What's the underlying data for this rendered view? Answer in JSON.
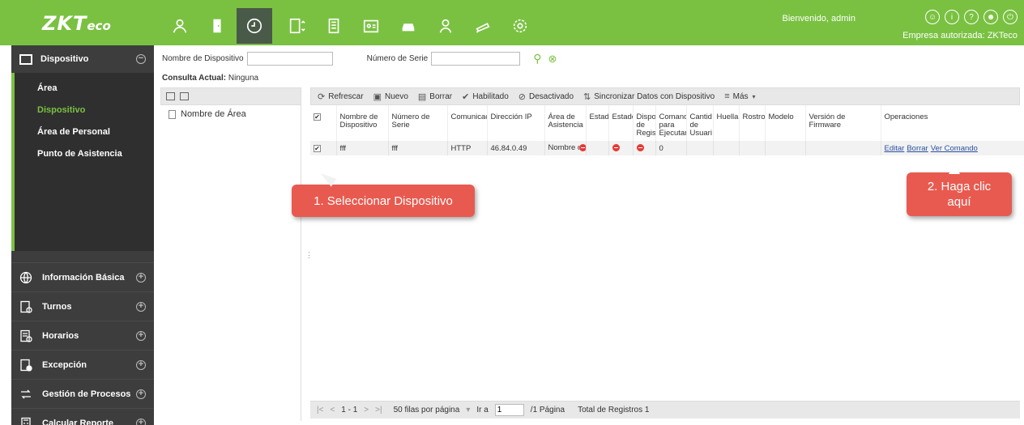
{
  "brand": {
    "logo_main": "ZKT",
    "logo_tail": "eco"
  },
  "topbar": {
    "modules": [
      "personnel-icon",
      "door-icon",
      "attendance-clock-icon",
      "elevator-icon",
      "building-icon",
      "id-card-icon",
      "car-icon",
      "guard-icon",
      "camera-icon",
      "settings-gear-icon"
    ],
    "welcome": "Bienvenido, admin",
    "company": "Empresa autorizada: ZKTeco",
    "icons": [
      "user-circle-icon",
      "info-icon",
      "help-icon",
      "profile-icon",
      "power-icon"
    ]
  },
  "sidebar": {
    "header": "Dispositivo",
    "subitems": [
      "Área",
      "Dispositivo",
      "Área de Personal",
      "Punto de Asistencia"
    ],
    "sections": [
      "Información Básica",
      "Turnos",
      "Horarios",
      "Excepción",
      "Gestión de Procesos",
      "Calcular Reporte"
    ]
  },
  "filter": {
    "device_name_label": "Nombre de Dispositivo",
    "serial_label": "Número de Serie",
    "consulta_label": "Consulta Actual:",
    "consulta_value": "Ninguna"
  },
  "tree": {
    "node": "Nombre de Área"
  },
  "toolbar": [
    "Refrescar",
    "Nuevo",
    "Borrar",
    "Habilitado",
    "Desactivado",
    "Sincronizar Datos con Dispositivo",
    "Más"
  ],
  "table": {
    "headers": [
      "Nombre de Dispositivo",
      "Número de Serie",
      "Comunicac",
      "Dirección IP",
      "Área de Asistencia",
      "Estado",
      "Estado",
      "Dispos de Regist",
      "Comand para Ejecutar",
      "Cantid de Usuari",
      "Huella",
      "Rostro",
      "Modelo",
      "Versión de Firmware",
      "Operaciones"
    ],
    "row": {
      "name": "fff",
      "serial": "fff",
      "comm": "HTTP",
      "ip": "46.84.0.49",
      "area": "Nombre de Área",
      "commands": "0",
      "ops": [
        "Editar",
        "Borrar",
        "Ver Comando"
      ]
    }
  },
  "pager": {
    "range": "1 - 1",
    "per_page": "50 filas por página",
    "goto_label": "Ir a",
    "page_value": "1",
    "pages": "/1 Página",
    "total": "Total de Registros 1"
  },
  "callouts": {
    "select": "1. Seleccionar Dispositivo",
    "click": "2. Haga clic aquí"
  }
}
